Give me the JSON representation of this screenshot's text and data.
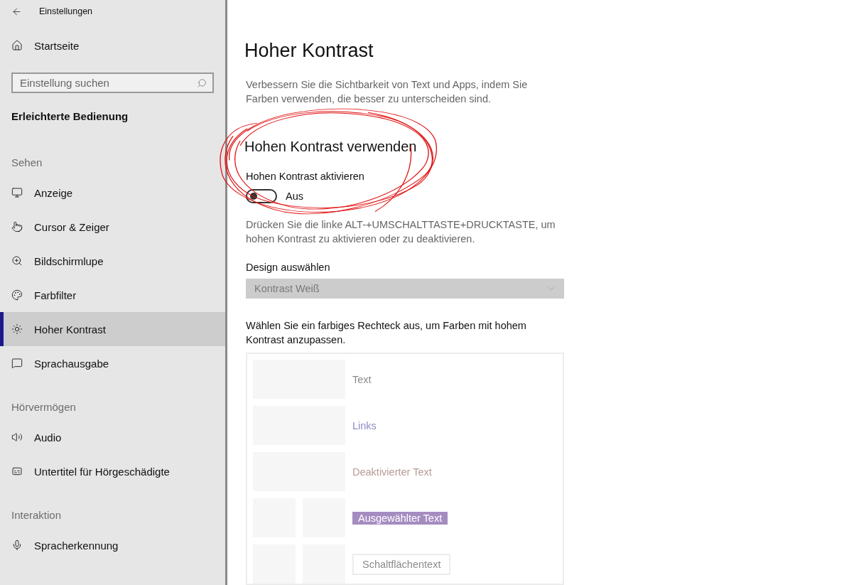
{
  "window": {
    "title": "Einstellungen"
  },
  "sidebar": {
    "home": "Startseite",
    "search": {
      "placeholder": "Einstellung suchen"
    },
    "category": "Erleichterte Bedienung",
    "groups": [
      {
        "heading": "Sehen",
        "items": [
          {
            "label": "Anzeige",
            "selected": false
          },
          {
            "label": "Cursor & Zeiger",
            "selected": false
          },
          {
            "label": "Bildschirmlupe",
            "selected": false
          },
          {
            "label": "Farbfilter",
            "selected": false
          },
          {
            "label": "Hoher Kontrast",
            "selected": true
          },
          {
            "label": "Sprachausgabe",
            "selected": false
          }
        ]
      },
      {
        "heading": "Hörvermögen",
        "items": [
          {
            "label": "Audio",
            "selected": false
          },
          {
            "label": "Untertitel für Hörgeschädigte",
            "selected": false
          }
        ]
      },
      {
        "heading": "Interaktion",
        "items": [
          {
            "label": "Spracherkennung",
            "selected": false
          }
        ]
      }
    ]
  },
  "main": {
    "title": "Hoher Kontrast",
    "description": "Verbessern Sie die Sichtbarkeit von Text und Apps, indem Sie Farben verwenden, die besser zu unterscheiden sind.",
    "section": "Hohen Kontrast verwenden",
    "toggle": {
      "label": "Hohen Kontrast aktivieren",
      "on": false,
      "state_text": "Aus"
    },
    "hint": "Drücken Sie die linke ALT-+UMSCHALTTASTE+DRUCKTASTE, um hohen Kontrast zu aktivieren oder zu deaktivieren.",
    "theme": {
      "label": "Design auswählen",
      "value": "Kontrast Weiß",
      "disabled": true
    },
    "colors_intro": "Wählen Sie ein farbiges Rechteck aus, um Farben mit hohem Kontrast anzupassen.",
    "colors": [
      {
        "kind": "text",
        "label": "Text"
      },
      {
        "kind": "link",
        "label": "Links"
      },
      {
        "kind": "disabled",
        "label": "Deaktivierter Text"
      },
      {
        "kind": "selected",
        "label": "Ausgewählter Text"
      },
      {
        "kind": "button",
        "label": "Schaltflächentext"
      }
    ]
  }
}
